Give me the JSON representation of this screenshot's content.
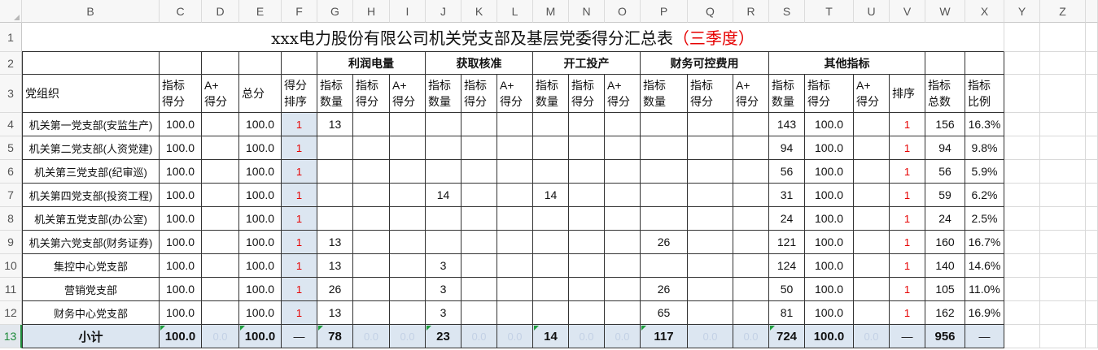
{
  "sheet": {
    "column_headers": [
      "B",
      "C",
      "D",
      "E",
      "F",
      "G",
      "H",
      "I",
      "J",
      "K",
      "L",
      "M",
      "N",
      "O",
      "P",
      "Q",
      "R",
      "S",
      "T",
      "U",
      "V",
      "W",
      "X",
      "Y",
      "Z"
    ],
    "row_numbers": [
      "1",
      "2",
      "3",
      "4",
      "5",
      "6",
      "7",
      "8",
      "9",
      "10",
      "11",
      "12",
      "13"
    ],
    "selected_row": 13
  },
  "table": {
    "title": {
      "text": "xxx电力股份有限公司机关党支部及基层党委得分汇总表",
      "highlight": "（三季度）"
    },
    "group_headers": [
      "利润电量",
      "获取核准",
      "开工投产",
      "财务可控费用",
      "其他指标"
    ],
    "field_headers": [
      "党组织",
      "指标\n得分",
      "A+\n得分",
      "总分",
      "得分\n排序",
      "指标\n数量",
      "指标\n得分",
      "A+\n得分",
      "指标\n数量",
      "指标\n得分",
      "A+\n得分",
      "指标\n数量",
      "指标\n得分",
      "A+\n得分",
      "指标\n数量",
      "指标\n得分",
      "A+\n得分",
      "指标\n数量",
      "指标\n得分",
      "A+\n得分",
      "排序",
      "指标\n总数",
      "指标\n比例"
    ],
    "rows": [
      {
        "cells": {
          "B": "机关第一党支部(安监生产)",
          "C": "100.0",
          "E": "100.0",
          "F": "1",
          "G": "13",
          "S": "143",
          "T": "100.0",
          "V": "1",
          "W": "156",
          "X": "16.3%"
        }
      },
      {
        "cells": {
          "B": "机关第二党支部(人资党建)",
          "C": "100.0",
          "E": "100.0",
          "F": "1",
          "S": "94",
          "T": "100.0",
          "V": "1",
          "W": "94",
          "X": "9.8%"
        }
      },
      {
        "cells": {
          "B": "机关第三党支部(纪审巡)",
          "C": "100.0",
          "E": "100.0",
          "F": "1",
          "S": "56",
          "T": "100.0",
          "V": "1",
          "W": "56",
          "X": "5.9%"
        }
      },
      {
        "cells": {
          "B": "机关第四党支部(投资工程)",
          "C": "100.0",
          "E": "100.0",
          "F": "1",
          "J": "14",
          "M": "14",
          "S": "31",
          "T": "100.0",
          "V": "1",
          "W": "59",
          "X": "6.2%"
        }
      },
      {
        "cells": {
          "B": "机关第五党支部(办公室)",
          "C": "100.0",
          "E": "100.0",
          "F": "1",
          "S": "24",
          "T": "100.0",
          "V": "1",
          "W": "24",
          "X": "2.5%"
        }
      },
      {
        "cells": {
          "B": "机关第六党支部(财务证券)",
          "C": "100.0",
          "E": "100.0",
          "F": "1",
          "G": "13",
          "P": "26",
          "S": "121",
          "T": "100.0",
          "V": "1",
          "W": "160",
          "X": "16.7%"
        }
      },
      {
        "cells": {
          "B": "集控中心党支部",
          "C": "100.0",
          "E": "100.0",
          "F": "1",
          "G": "13",
          "J": "3",
          "S": "124",
          "T": "100.0",
          "V": "1",
          "W": "140",
          "X": "14.6%"
        }
      },
      {
        "cells": {
          "B": "营销党支部",
          "C": "100.0",
          "E": "100.0",
          "F": "1",
          "G": "26",
          "J": "3",
          "P": "26",
          "S": "50",
          "T": "100.0",
          "V": "1",
          "W": "105",
          "X": "11.0%"
        }
      },
      {
        "cells": {
          "B": "财务中心党支部",
          "C": "100.0",
          "E": "100.0",
          "F": "1",
          "G": "13",
          "J": "3",
          "P": "65",
          "S": "81",
          "T": "100.0",
          "V": "1",
          "W": "162",
          "X": "16.9%"
        }
      }
    ],
    "total_row": {
      "cells": {
        "B": "小计",
        "C": "100.0",
        "D": "0.0",
        "E": "100.0",
        "F": "—",
        "G": "78",
        "H": "0.0",
        "I": "0.0",
        "J": "23",
        "K": "0.0",
        "L": "0.0",
        "M": "14",
        "N": "0.0",
        "O": "0.0",
        "P": "117",
        "Q": "0.0",
        "R": "0.0",
        "S": "724",
        "T": "100.0",
        "U": "0.0",
        "V": "—",
        "W": "956",
        "X": "—"
      }
    }
  },
  "colors": {
    "title_highlight": "#e60000",
    "rank_value": "#e60000",
    "rank_column_fill": "#dce6f1",
    "selected_row_fill": "#dce6f1",
    "selected_row_number": "#1e8a3a",
    "formula_warning": "#1f9d3d",
    "border": "#333333",
    "gridline": "#d9d9d9",
    "header_fill": "#f7f7f7",
    "total_zero_text": "#c3d1e5"
  }
}
